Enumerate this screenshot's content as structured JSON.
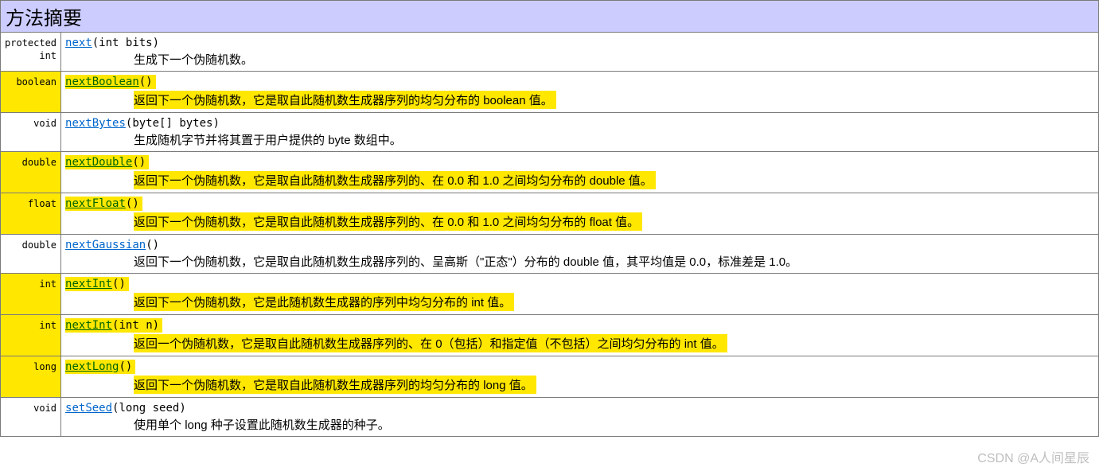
{
  "header": "方法摘要",
  "watermark": "CSDN @A人间星辰",
  "rows": [
    {
      "modifier": "protected\n int",
      "link": "next",
      "params": "(int bits)",
      "desc": "生成下一个伪随机数。",
      "highlighted": false
    },
    {
      "modifier": "boolean",
      "link": "nextBoolean",
      "params": "()",
      "desc": "返回下一个伪随机数，它是取自此随机数生成器序列的均匀分布的 boolean 值。",
      "highlighted": true
    },
    {
      "modifier": "void",
      "link": "nextBytes",
      "params": "(byte[] bytes)",
      "desc": "生成随机字节并将其置于用户提供的 byte 数组中。",
      "highlighted": false
    },
    {
      "modifier": "double",
      "link": "nextDouble",
      "params": "()",
      "desc": "返回下一个伪随机数，它是取自此随机数生成器序列的、在 0.0 和 1.0 之间均匀分布的 double 值。",
      "highlighted": true
    },
    {
      "modifier": "float",
      "link": "nextFloat",
      "params": "()",
      "desc": "返回下一个伪随机数，它是取自此随机数生成器序列的、在 0.0 和 1.0 之间均匀分布的 float 值。",
      "highlighted": true
    },
    {
      "modifier": "double",
      "link": "nextGaussian",
      "params": "()",
      "desc": "返回下一个伪随机数，它是取自此随机数生成器序列的、呈高斯（\"正态\"）分布的 double 值，其平均值是 0.0，标准差是 1.0。",
      "highlighted": false
    },
    {
      "modifier": "int",
      "link": "nextInt",
      "params": "()",
      "desc": "返回下一个伪随机数，它是此随机数生成器的序列中均匀分布的 int 值。",
      "highlighted": true
    },
    {
      "modifier": "int",
      "link": "nextInt",
      "params": "(int n)",
      "desc": "返回一个伪随机数，它是取自此随机数生成器序列的、在 0（包括）和指定值（不包括）之间均匀分布的 int 值。",
      "highlighted": true
    },
    {
      "modifier": "long",
      "link": "nextLong",
      "params": "()",
      "desc": "返回下一个伪随机数，它是取自此随机数生成器序列的均匀分布的 long 值。",
      "highlighted": true
    },
    {
      "modifier": "void",
      "link": "setSeed",
      "params": "(long seed)",
      "desc": "使用单个 long 种子设置此随机数生成器的种子。",
      "highlighted": false
    }
  ]
}
